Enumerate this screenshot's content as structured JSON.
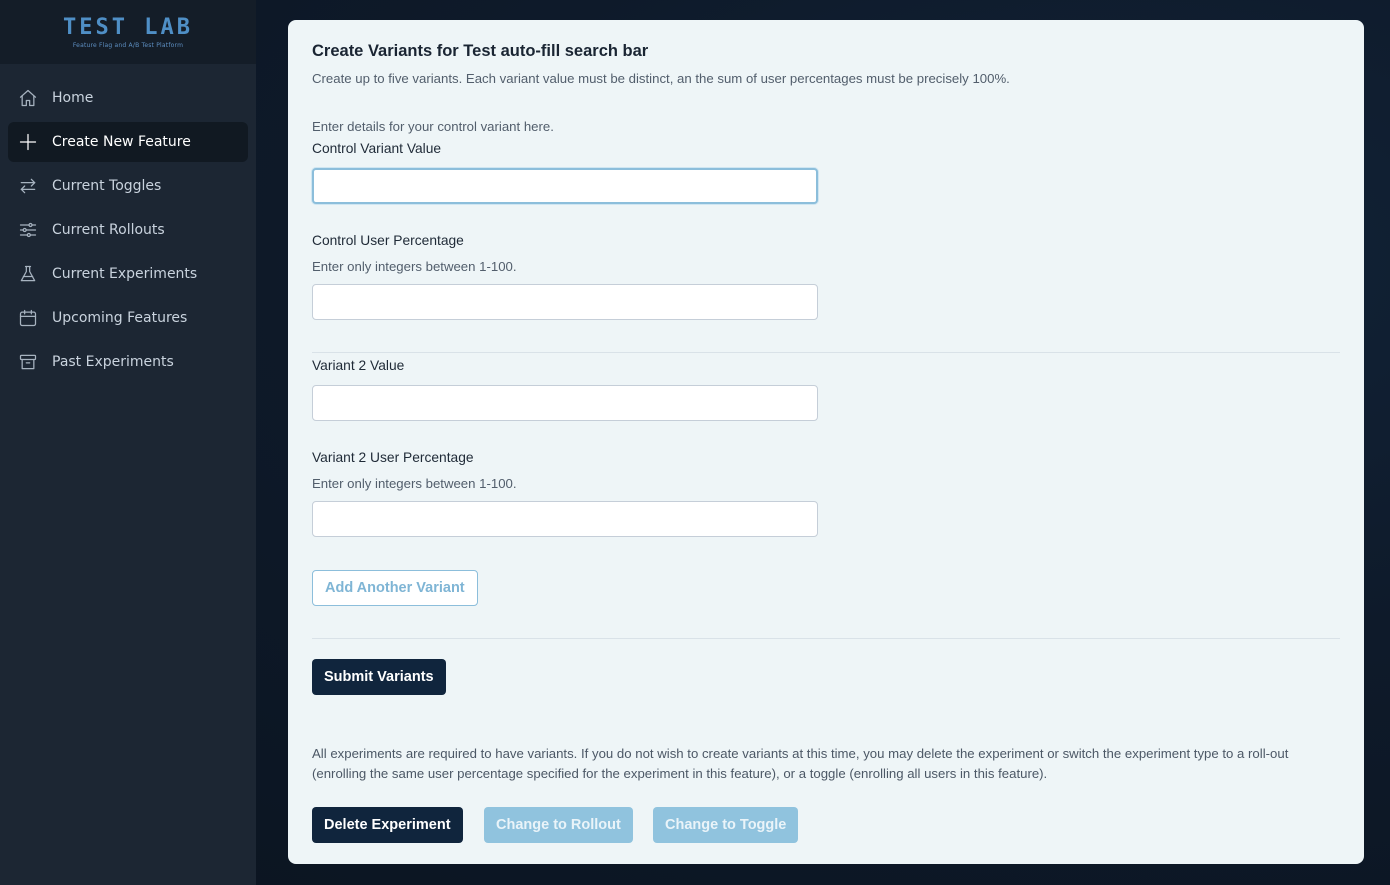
{
  "app": {
    "logo_title": "TEST LAB",
    "logo_subtitle": "Feature Flag and A/B Test Platform"
  },
  "sidebar": {
    "items": [
      {
        "label": "Home",
        "icon": "home-icon",
        "active": false
      },
      {
        "label": "Create New Feature",
        "icon": "plus-icon",
        "active": true
      },
      {
        "label": "Current Toggles",
        "icon": "arrows-swap-icon",
        "active": false
      },
      {
        "label": "Current Rollouts",
        "icon": "sliders-icon",
        "active": false
      },
      {
        "label": "Current Experiments",
        "icon": "flask-icon",
        "active": false
      },
      {
        "label": "Upcoming Features",
        "icon": "calendar-icon",
        "active": false
      },
      {
        "label": "Past Experiments",
        "icon": "archive-icon",
        "active": false
      }
    ]
  },
  "main": {
    "title": "Create Variants for Test auto-fill search bar",
    "description": "Create up to five variants. Each variant value must be distinct, an the sum of user percentages must be precisely 100%.",
    "control_intro": "Enter details for your control variant here.",
    "control_value_label": "Control Variant Value",
    "control_value": "",
    "control_pct_label": "Control User Percentage",
    "control_pct_help": "Enter only integers between 1-100.",
    "control_pct_value": "",
    "variant2_value_label": "Variant 2 Value",
    "variant2_value": "",
    "variant2_pct_label": "Variant 2 User Percentage",
    "variant2_pct_help": "Enter only integers between 1-100.",
    "variant2_pct_value": "",
    "add_variant_label": "Add Another Variant",
    "submit_label": "Submit Variants",
    "footer_text": "All experiments are required to have variants. If you do not wish to create variants at this time, you may delete the experiment or switch the experiment type to a roll-out (enrolling the same user percentage specified for the experiment in this feature), or a toggle (enrolling all users in this feature).",
    "delete_label": "Delete Experiment",
    "rollout_label": "Change to Rollout",
    "toggle_label": "Change to Toggle"
  },
  "colors": {
    "sidebar_bg": "#1c2633",
    "card_bg": "#eef5f7",
    "primary_dark": "#10253d",
    "accent_light": "#90c3de",
    "logo_blue": "#4f8fc6"
  }
}
